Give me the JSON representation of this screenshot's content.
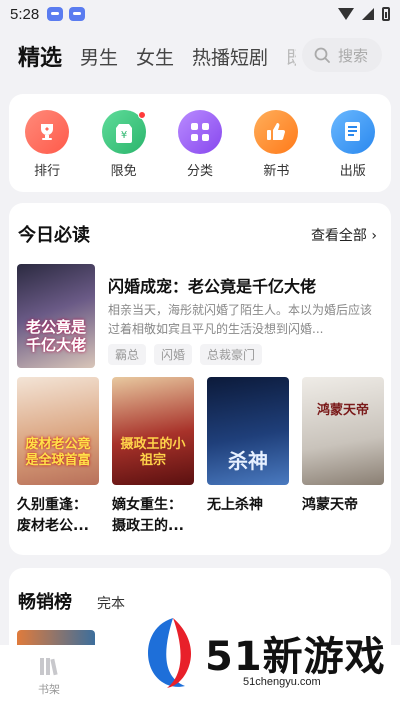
{
  "status_bar": {
    "time": "5:28"
  },
  "tabs": [
    {
      "label": "精选"
    },
    {
      "label": "男生"
    },
    {
      "label": "女生"
    },
    {
      "label": "热播短剧"
    },
    {
      "label": "既"
    }
  ],
  "search": {
    "placeholder": "搜索"
  },
  "quick_entries": [
    {
      "label": "排行",
      "icon": "trophy-icon",
      "color": "#ff6b5b"
    },
    {
      "label": "限免",
      "icon": "free-tag-icon",
      "color": "#3cc47c"
    },
    {
      "label": "分类",
      "icon": "grid-icon",
      "color": "#9b5cf0"
    },
    {
      "label": "新书",
      "icon": "thumb-up-icon",
      "color": "#ff8a2a"
    },
    {
      "label": "出版",
      "icon": "book-icon",
      "color": "#3a9cf5"
    }
  ],
  "today": {
    "title": "今日必读",
    "see_all": "查看全部",
    "featured": {
      "cover_text": "老公竟是千亿大佬",
      "title": "闪婚成宠：老公竟是千亿大佬",
      "description": "相亲当天，海彤就闪婚了陌生人。本以为婚后应该过着相敬如宾且平凡的生活没想到闪婚...",
      "tags": [
        "霸总",
        "闪婚",
        "总裁豪门"
      ]
    },
    "books": [
      {
        "title": "久别重逢：废材老公...",
        "cover_text": "废材老公竟是全球首富",
        "cover_color": "#d9a07a"
      },
      {
        "title": "嫡女重生：摄政王的...",
        "cover_text": "摄政王的小祖宗",
        "cover_color": "#a8322a"
      },
      {
        "title": "无上杀神",
        "cover_text": "杀神",
        "cover_color": "#1f3f7a"
      },
      {
        "title": "鸿蒙天帝",
        "cover_text": "鸿蒙天帝",
        "cover_color": "#c9c3bb"
      }
    ]
  },
  "bestseller": {
    "title": "畅销榜",
    "sub": "完本"
  },
  "bottom_nav": {
    "bookshelf": "书架"
  },
  "watermark": {
    "text": "51新游戏",
    "url": "51chengyu.com"
  }
}
